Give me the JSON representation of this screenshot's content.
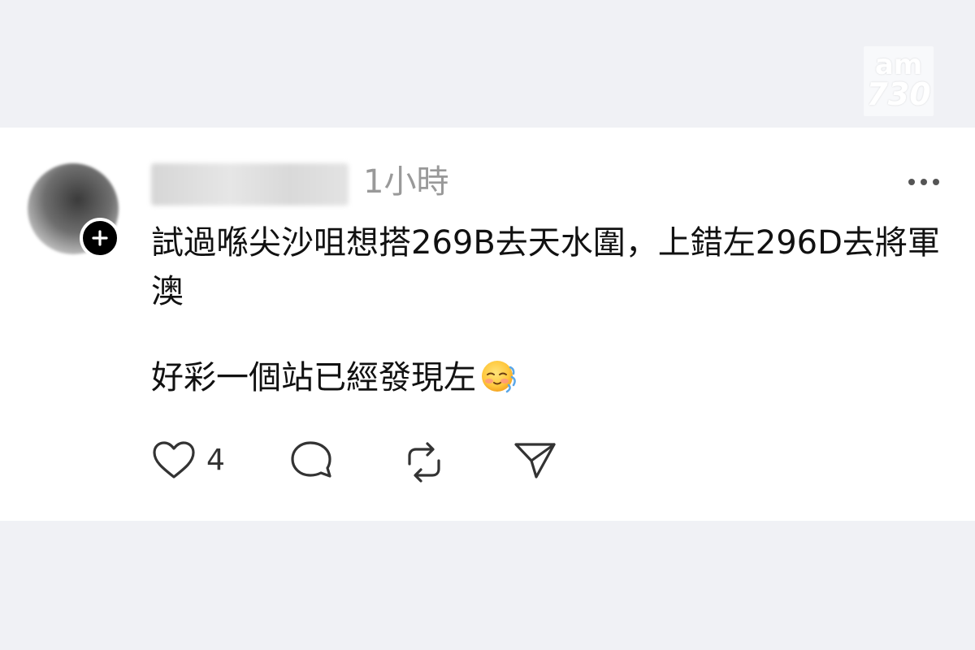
{
  "watermark": {
    "line1": "am",
    "line2": "730"
  },
  "post": {
    "timestamp": "1小時",
    "paragraphs": [
      "試過喺尖沙咀想搭269B去天水圍，上錯左296D去將軍澳",
      "好彩一個站已經發現左"
    ],
    "emoji": "face-holding-back-tears-emoji"
  },
  "actions": {
    "like_count": "4",
    "icons": [
      "heart-icon",
      "comment-icon",
      "repost-icon",
      "share-icon"
    ]
  },
  "colors": {
    "background": "#f0f1f5",
    "card": "#ffffff",
    "text": "#111111",
    "muted": "#999999"
  }
}
